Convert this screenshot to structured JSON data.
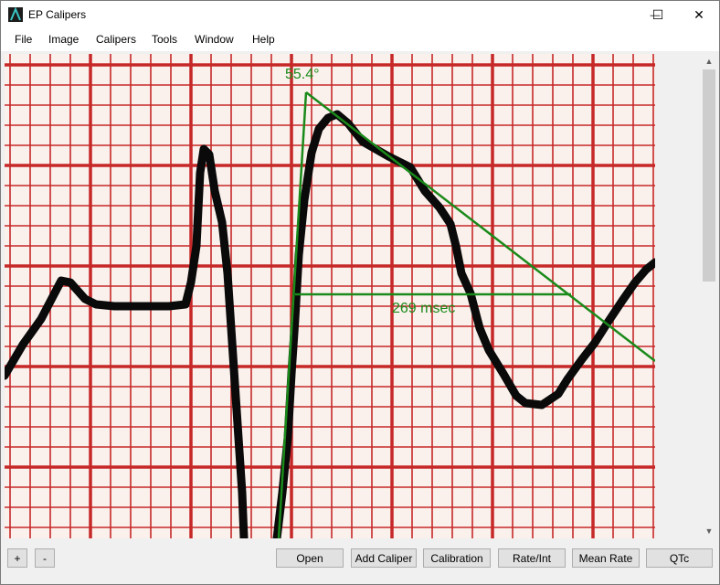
{
  "window": {
    "title": "EP Calipers",
    "minimize_glyph": "—",
    "maximize_glyph": "☐",
    "close_glyph": "✕"
  },
  "menu": {
    "items": [
      "File",
      "Image",
      "Calipers",
      "Tools",
      "Window",
      "Help"
    ]
  },
  "canvas": {
    "angle_caliper_label": "55.4°",
    "time_caliper_label": "269 msec",
    "caliper_color": "#1a8a1a",
    "grid_color": "#c62828",
    "paper_color": "#fbf1ec",
    "trace_color": "#000000"
  },
  "scrollbar": {
    "up_glyph": "▲",
    "down_glyph": "▼"
  },
  "buttons": {
    "zoom_in": "+",
    "zoom_out": "-",
    "open": "Open",
    "add_caliper": "Add Caliper",
    "calibration": "Calibration",
    "rate_int": "Rate/Int",
    "mean_rate": "Mean Rate",
    "qtc": "QTc"
  }
}
